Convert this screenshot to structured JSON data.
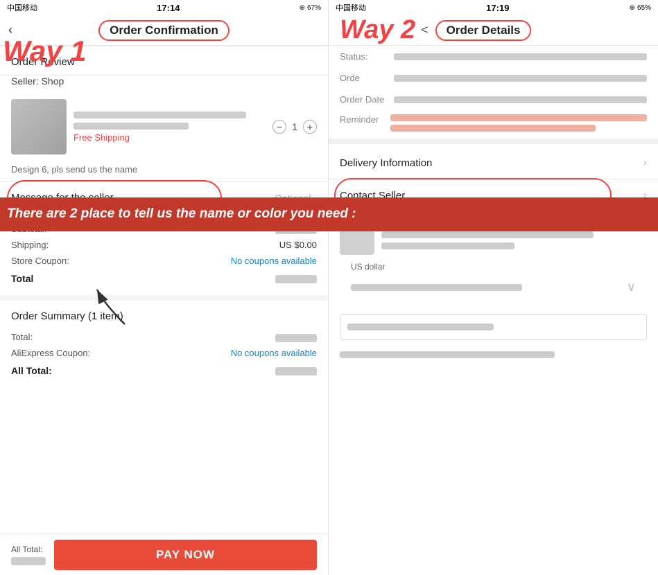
{
  "left": {
    "statusBar": {
      "carrier": "中国移动",
      "wifi": "WiFi",
      "time": "17:14",
      "battery": "67%"
    },
    "header": {
      "backLabel": "‹",
      "title": "Order Confirmation"
    },
    "wayLabel": "Way 1",
    "sections": {
      "orderReview": "Order Review",
      "sellerLabel": "Seller:  Shop",
      "freeShipping": "Free Shipping",
      "designNote": "Design 6, pls send us the name",
      "messageLabel": "Message for the seller",
      "optionalLabel": "Optional",
      "subtotalLabel": "Subtotal:",
      "shippingLabel": "Shipping:",
      "shippingValue": "US $0.00",
      "storeCouponLabel": "Store Coupon:",
      "noCouponsValue": "No coupons available",
      "totalLabel": "Total",
      "orderSummaryTitle": "Order Summary (1 item)",
      "totalLabel2": "Total:",
      "aliexpressCouponLabel": "AliExpress Coupon:",
      "noCouponsValue2": "No coupons available",
      "allTotalLabel": "All Total:",
      "allTotalLabel2": "All Total:",
      "payNowLabel": "PAY NOW"
    },
    "qty": {
      "minus": "−",
      "value": "1",
      "plus": "+"
    }
  },
  "right": {
    "statusBar": {
      "carrier": "中国移动",
      "wifi": "WiFi",
      "time": "17:19",
      "battery": "65%"
    },
    "header": {
      "backLabel": "<",
      "title": "Order Details"
    },
    "wayLabel": "Way 2",
    "sections": {
      "statusLabel": "Status:",
      "orderLabel": "Orde",
      "orderDateLabel": "Order Date",
      "reminderLabel": "Reminder",
      "deliveryLabel": "Delivery Information",
      "contactLabel": "Contact Seller",
      "usDollarLabel": "US dollar"
    }
  },
  "banner": {
    "text": "There are 2 place to tell us the name or color you need :"
  },
  "colors": {
    "accent": "#e84b3a",
    "circleRed": "#e44444",
    "linkBlue": "#1a7fc1"
  }
}
